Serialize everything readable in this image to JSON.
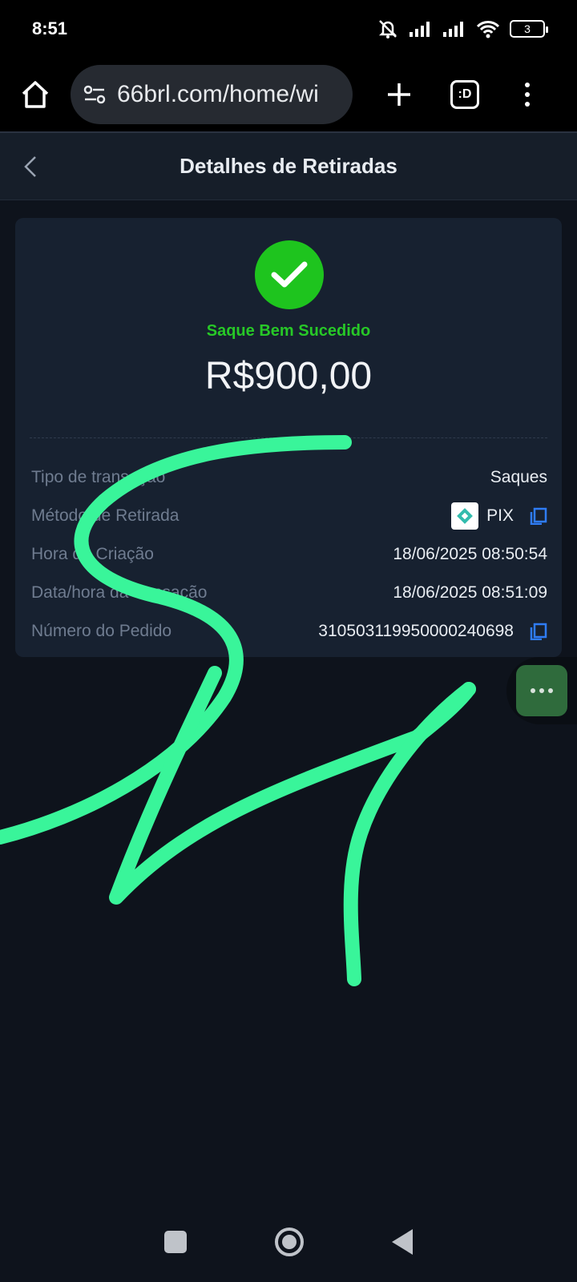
{
  "status_bar": {
    "time": "8:51",
    "battery": "3"
  },
  "browser": {
    "url": "66brl.com/home/wi",
    "tabs_label": ":D"
  },
  "header": {
    "title": "Detalhes de Retiradas"
  },
  "summary": {
    "status": "Saque Bem Sucedido",
    "amount": "R$900,00"
  },
  "details": {
    "rows": [
      {
        "label": "Tipo de transação",
        "value": "Saques"
      },
      {
        "label": "Método de Retirada",
        "value": "PIX"
      },
      {
        "label": "Hora de Criação",
        "value": "18/06/2025 08:50:54"
      },
      {
        "label": "Data/hora da transação",
        "value": "18/06/2025 08:51:09"
      },
      {
        "label": "Número do Pedido",
        "value": "310503119950000240698"
      }
    ]
  },
  "colors": {
    "success": "#1ec41e",
    "copy_icon": "#2f7cf6",
    "scribble": "#39f59a",
    "background": "#0e131c",
    "card": "#172130"
  },
  "icons": {
    "home": "home-icon",
    "site_settings": "site-settings-icon",
    "new_tab": "plus-icon",
    "tabs": "tabs-icon",
    "menu": "more-vert-icon",
    "back": "chevron-left-icon",
    "success": "check-icon",
    "pix": "pix-logo-icon",
    "copy": "copy-icon",
    "floating": "more-horiz-icon"
  }
}
